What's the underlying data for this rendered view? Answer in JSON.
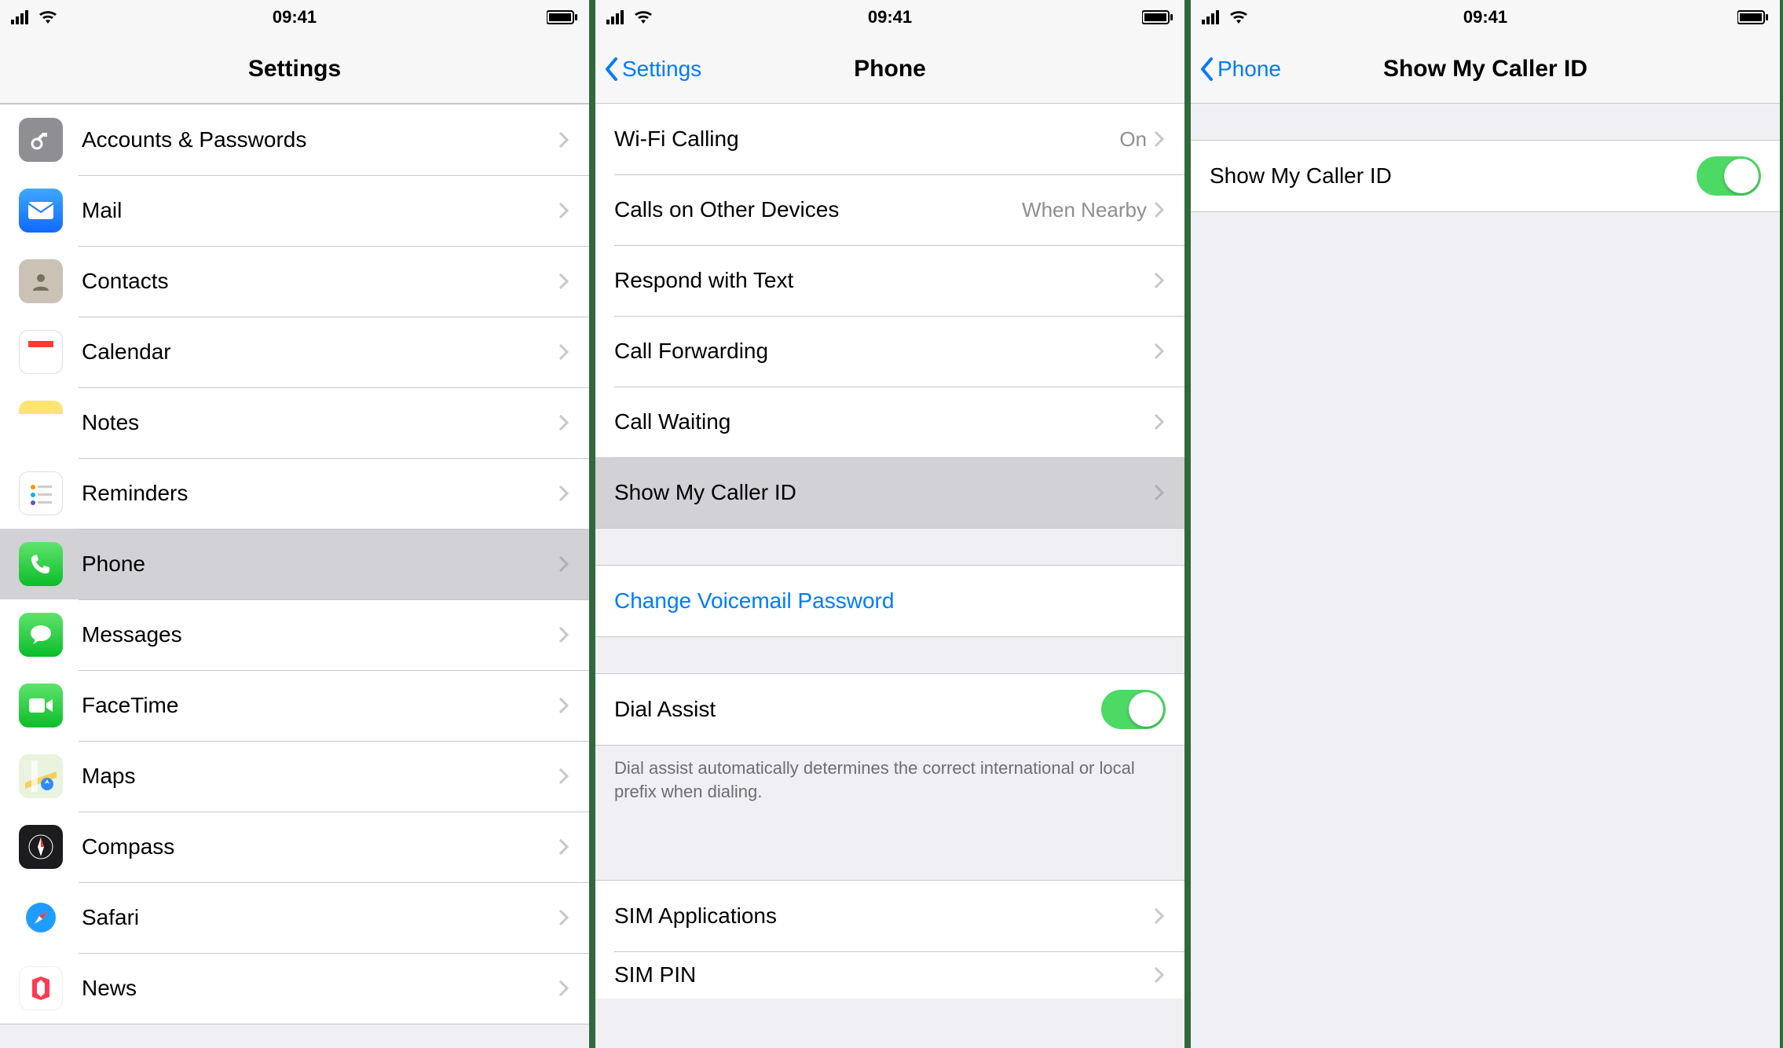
{
  "status_time": "09:41",
  "screens": {
    "settings": {
      "title": "Settings",
      "rows": [
        {
          "icon": "key",
          "label": "Accounts & Passwords"
        },
        {
          "icon": "mail",
          "label": "Mail"
        },
        {
          "icon": "contacts",
          "label": "Contacts"
        },
        {
          "icon": "calendar",
          "label": "Calendar"
        },
        {
          "icon": "notes",
          "label": "Notes"
        },
        {
          "icon": "reminders",
          "label": "Reminders"
        },
        {
          "icon": "phone",
          "label": "Phone",
          "selected": true
        },
        {
          "icon": "messages",
          "label": "Messages"
        },
        {
          "icon": "facetime",
          "label": "FaceTime"
        },
        {
          "icon": "maps",
          "label": "Maps"
        },
        {
          "icon": "compass",
          "label": "Compass"
        },
        {
          "icon": "safari",
          "label": "Safari"
        },
        {
          "icon": "news",
          "label": "News"
        }
      ]
    },
    "phone": {
      "back": "Settings",
      "title": "Phone",
      "section1": [
        {
          "label": "Wi-Fi Calling",
          "value": "On"
        },
        {
          "label": "Calls on Other Devices",
          "value": "When Nearby"
        },
        {
          "label": "Respond with Text"
        },
        {
          "label": "Call Forwarding"
        },
        {
          "label": "Call Waiting"
        },
        {
          "label": "Show My Caller ID",
          "selected": true
        }
      ],
      "voicemail_label": "Change Voicemail Password",
      "dial_assist_label": "Dial Assist",
      "dial_assist_on": true,
      "dial_assist_note": "Dial assist automatically determines the correct international or local prefix when dialing.",
      "section_sim": [
        {
          "label": "SIM Applications"
        },
        {
          "label": "SIM PIN"
        }
      ]
    },
    "caller_id": {
      "back": "Phone",
      "title": "Show My Caller ID",
      "row_label": "Show My Caller ID",
      "on": true
    }
  }
}
